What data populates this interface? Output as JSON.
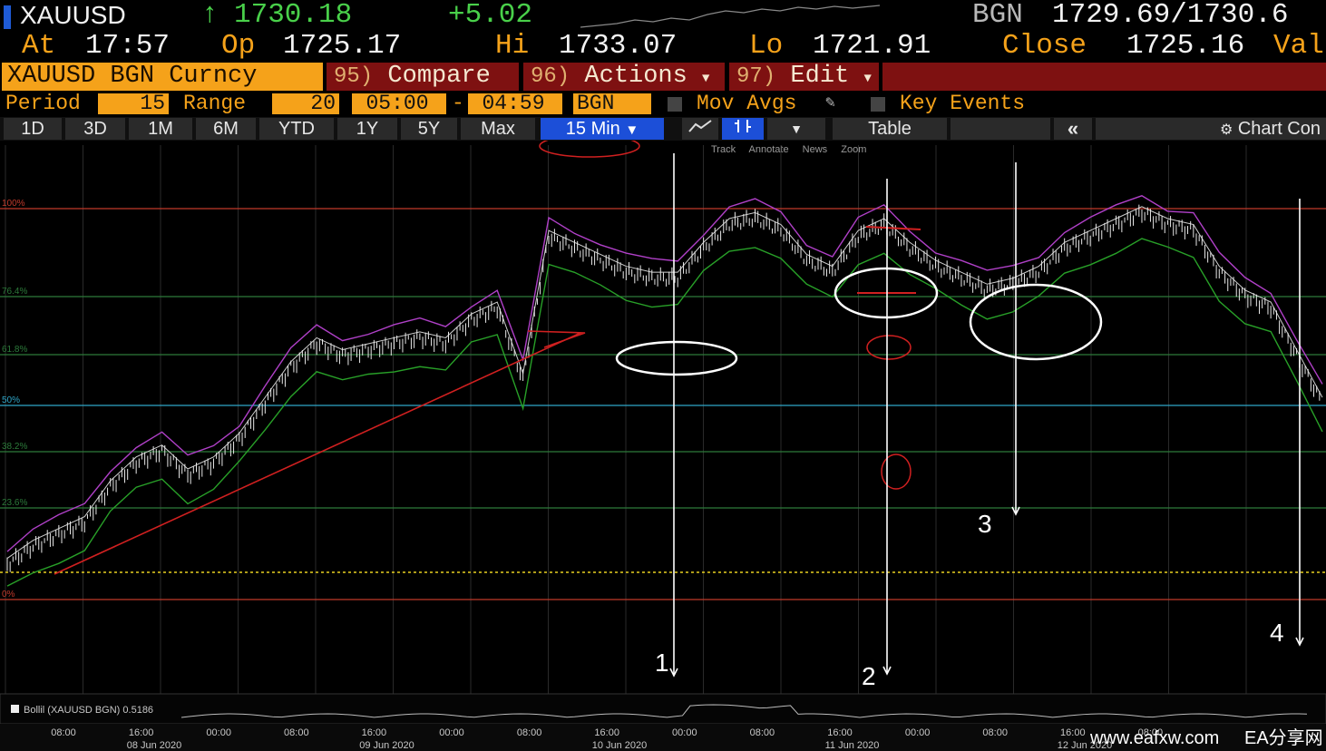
{
  "header": {
    "ticker": "XAUUSD",
    "arrow": "↑",
    "last": "1730.18",
    "change": "+5.02",
    "source": "BGN",
    "bid_ask": "1729.69/1730.6",
    "at_label": "At",
    "time": "17:57",
    "op_label": "Op",
    "open": "1725.17",
    "hi_label": "Hi",
    "high": "1733.07",
    "lo_label": "Lo",
    "low": "1721.91",
    "close_label": "Close",
    "close": "1725.16",
    "val_label": "Val"
  },
  "menu": {
    "security": "XAUUSD BGN Curncy",
    "compare_num": "95)",
    "compare": "Compare",
    "actions_num": "96)",
    "actions": "Actions",
    "edit_num": "97)",
    "edit": "Edit"
  },
  "settings": {
    "period_label": "Period",
    "period": "15",
    "range_label": "Range",
    "range": "20",
    "start": "05:00",
    "dash": "-",
    "end": "04:59",
    "source": "BGN",
    "mov_avgs": "Mov Avgs",
    "key_events": "Key Events"
  },
  "tabs": [
    "1D",
    "3D",
    "1M",
    "6M",
    "YTD",
    "1Y",
    "5Y",
    "Max"
  ],
  "interval": "15 Min",
  "table_label": "Table",
  "chart_con_label": "Chart Con",
  "tools": [
    "Track",
    "Annotate",
    "News",
    "Zoom"
  ],
  "indicator_label": "Bollil (XAUUSD BGN) 0.5186",
  "watermark": {
    "site": "www.eafxw.com",
    "brand": "EA分享网"
  },
  "chart_data": {
    "type": "line",
    "title": "",
    "series": [
      {
        "values": [
          1685,
          1688,
          1690,
          1692,
          1698,
          1702,
          1704,
          1700,
          1702,
          1706,
          1712,
          1718,
          1722,
          1720,
          1721,
          1722,
          1723,
          1722,
          1726,
          1728,
          1716,
          1740,
          1738,
          1736,
          1734,
          1733,
          1733,
          1738,
          1742,
          1743,
          1741,
          1736,
          1734,
          1740,
          1742,
          1738,
          1735,
          1733,
          1731,
          1732,
          1734,
          1738,
          1740,
          1742,
          1744,
          1742,
          1741,
          1734,
          1730,
          1728,
          1720,
          1712
        ]
      }
    ],
    "fib_levels": [
      {
        "label": "100%",
        "color": "#c0392b"
      },
      {
        "label": "76.4%",
        "color": "#2c7a3a"
      },
      {
        "label": "61.8%",
        "color": "#2c7a3a"
      },
      {
        "label": "50%",
        "color": "#2fa6c8"
      },
      {
        "label": "38.2%",
        "color": "#2c7a3a"
      },
      {
        "label": "23.6%",
        "color": "#2c7a3a"
      },
      {
        "label": "0%",
        "color": "#c0392b"
      }
    ],
    "x_ticks": [
      "08:00",
      "16:00",
      "00:00",
      "08:00",
      "16:00",
      "00:00",
      "08:00",
      "16:00",
      "00:00",
      "08:00",
      "16:00",
      "00:00",
      "08:00",
      "16:00",
      "08:00"
    ],
    "date_labels": [
      "08 Jun 2020",
      "09 Jun 2020",
      "10 Jun 2020",
      "11 Jun 2020",
      "12 Jun 2020"
    ],
    "annotations": [
      "1",
      "2",
      "3",
      "4"
    ],
    "grid": true
  }
}
